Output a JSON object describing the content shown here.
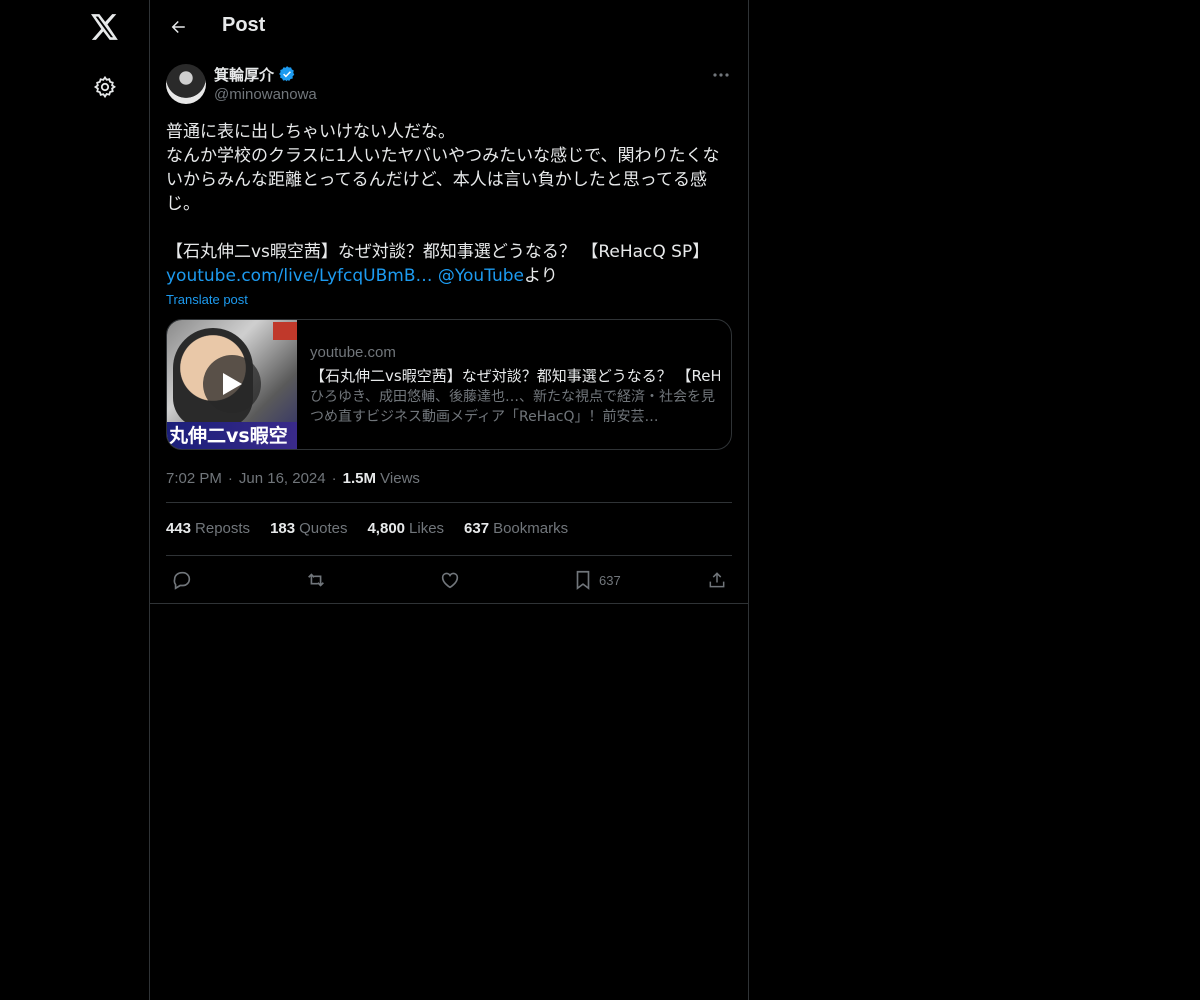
{
  "header": {
    "title": "Post"
  },
  "post": {
    "author": {
      "display_name": "箕輪厚介",
      "handle": "@minowanowa"
    },
    "text_lines": [
      "普通に表に出しちゃいけない人だな。",
      "なんか学校のクラスに1人いたヤバいやつみたいな感じで、関わりたくないからみんな距離とってるんだけど、本人は言い負かしたと思ってる感じ。"
    ],
    "quote_title": "【石丸伸二vs暇空茜】なぜ対談？都知事選どうなる？ 【ReHacQ SP】",
    "link_text": "youtube.com/live/LyfcqUBmB…",
    "mention_text": "@YouTube",
    "link_suffix": "より",
    "translate_label": "Translate post",
    "card": {
      "domain": "youtube.com",
      "title": "【石丸伸二vs暇空茜】なぜ対談？都知事選どうなる？ 【ReHacQ SP】",
      "description": "ひろゆき、成田悠輔、後藤達也…、新たな視点で経済・社会を見つめ直すビジネス動画メディア「ReHacQ」！前安芸…",
      "thumb_text": "丸伸二vs暇空"
    },
    "meta": {
      "time": "7:02 PM",
      "date": "Jun 16, 2024",
      "views_count": "1.5M",
      "views_label": "Views",
      "separator": "·"
    },
    "stats": {
      "reposts": {
        "count": "443",
        "label": "Reposts"
      },
      "quotes": {
        "count": "183",
        "label": "Quotes"
      },
      "likes": {
        "count": "4,800",
        "label": "Likes"
      },
      "bookmarks": {
        "count": "637",
        "label": "Bookmarks"
      }
    },
    "actions": {
      "bookmark_count": "637"
    }
  },
  "colors": {
    "accent": "#1d9bf0",
    "muted": "#71767b",
    "text": "#e7e9ea",
    "border": "#2f3336",
    "background": "#000000"
  },
  "icons": [
    "x-logo-icon",
    "settings-gear-icon",
    "back-arrow-icon",
    "verified-badge-icon",
    "more-icon",
    "reply-icon",
    "repost-icon",
    "like-icon",
    "bookmark-icon",
    "share-icon",
    "play-icon"
  ]
}
